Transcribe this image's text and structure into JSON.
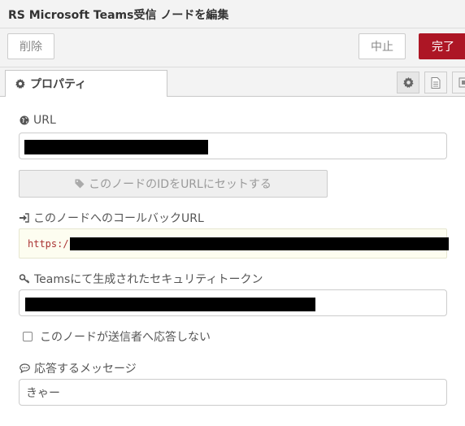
{
  "header": {
    "title": "RS Microsoft Teams受信 ノードを編集"
  },
  "toolbar": {
    "delete_label": "削除",
    "cancel_label": "中止",
    "done_label": "完了"
  },
  "tabs": {
    "properties_label": "プロパティ",
    "icons": [
      "gear-icon",
      "description-icon",
      "appearance-icon"
    ]
  },
  "form": {
    "url_label": "URL",
    "set_id_button": "このノードのIDをURLにセットする",
    "callback_label": "このノードへのコールバックURL",
    "callback_value": "https:/",
    "token_label": "Teamsにて生成されたセキュリティトークン",
    "no_reply_label": "このノードが送信者へ応答しない",
    "no_reply_checked": false,
    "message_label": "応答するメッセージ",
    "message_value": "きゃー"
  },
  "colors": {
    "done_button": "#ad1625",
    "callback_bg": "#fdfdf0"
  }
}
